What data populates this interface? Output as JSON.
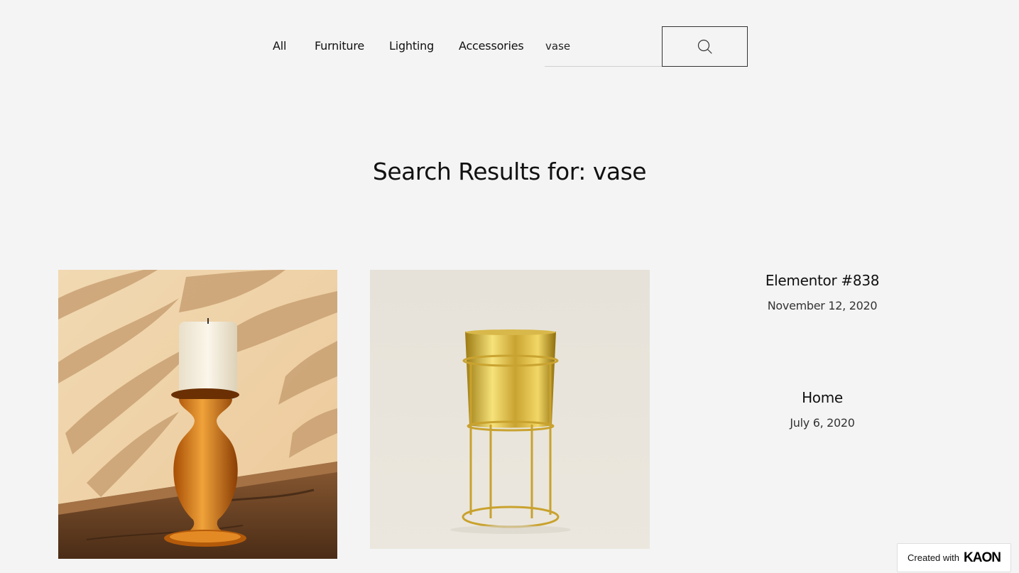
{
  "nav": {
    "items": [
      {
        "label": "All"
      },
      {
        "label": "Furniture"
      },
      {
        "label": "Lighting"
      },
      {
        "label": "Accessories"
      }
    ],
    "search": {
      "value": "vase",
      "icon": "search-icon"
    }
  },
  "page": {
    "title": "Search Results for: vase"
  },
  "results": {
    "images": [
      {
        "icon": "amber-glass-candle-holder-image"
      },
      {
        "icon": "gold-planter-stand-image"
      }
    ],
    "posts": [
      {
        "title": "Elementor #838",
        "date": "November 12, 2020"
      },
      {
        "title": "Home",
        "date": "July 6, 2020"
      }
    ]
  },
  "badge": {
    "text": "Created with",
    "logo": "KAON"
  }
}
